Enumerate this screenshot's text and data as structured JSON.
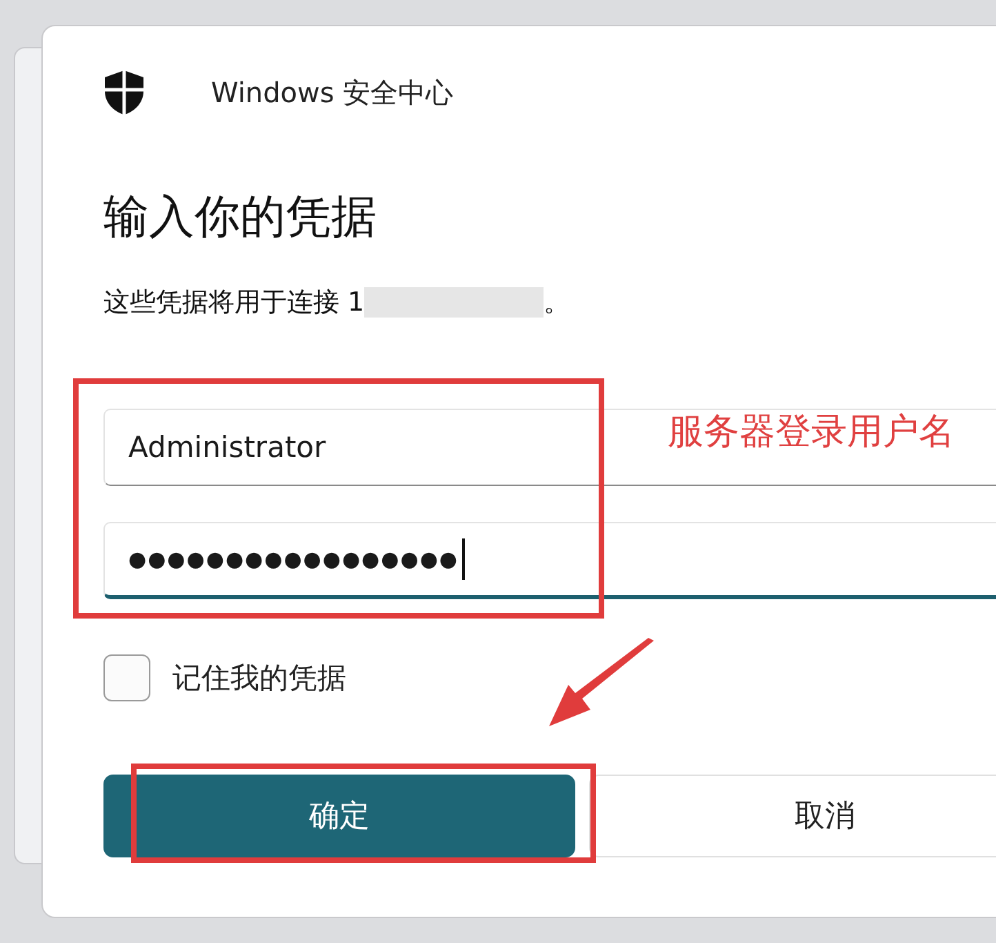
{
  "window": {
    "title": "Windows 安全中心"
  },
  "heading": "输入你的凭据",
  "description": {
    "prefix": "这些凭据将用于连接 1",
    "suffix": "。"
  },
  "username": {
    "value": "Administrator"
  },
  "password": {
    "value": "●●●●●●●●●●●●●●●●●",
    "focused": true
  },
  "remember": {
    "label": "记住我的凭据",
    "checked": false
  },
  "buttons": [
    {
      "label": "确定",
      "kind": "primary"
    },
    {
      "label": "取消",
      "kind": "secondary"
    }
  ],
  "annotation": {
    "text": "服务器登录用户名"
  }
}
